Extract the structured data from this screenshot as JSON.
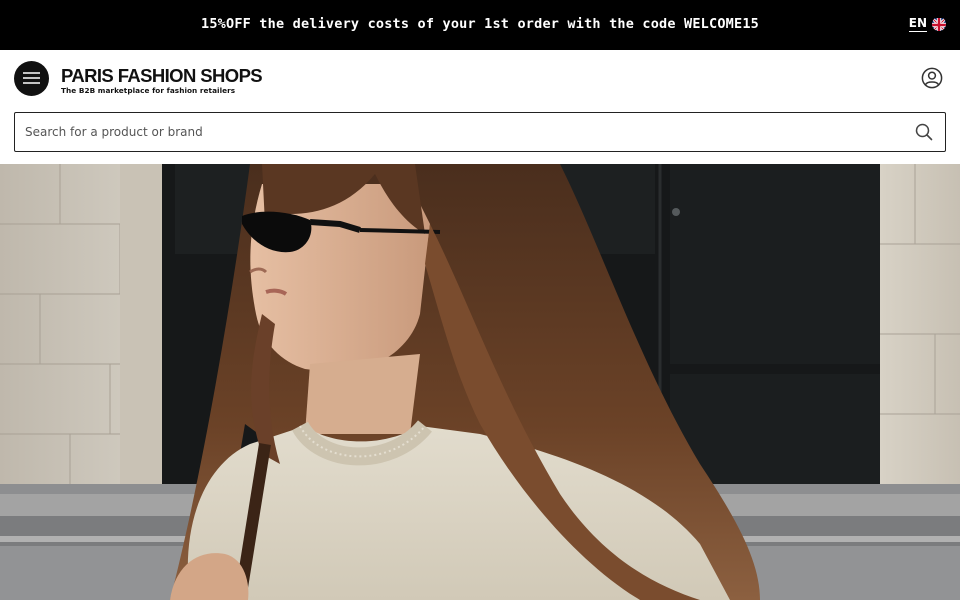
{
  "promo": {
    "text": "15%OFF the delivery costs of your 1st order with the code WELCOME15"
  },
  "language": {
    "code": "EN",
    "flag_icon": "uk-flag-icon"
  },
  "header": {
    "menu_icon": "hamburger-menu-icon",
    "logo_title": "PARIS FASHION SHOPS",
    "logo_tagline": "The B2B marketplace for fashion retailers",
    "account_icon": "user-account-icon"
  },
  "search": {
    "placeholder": "Search for a product or brand",
    "value": "",
    "icon": "search-icon"
  },
  "colors": {
    "promo_background": "#000000",
    "promo_text": "#ffffff",
    "brand_text": "#111111"
  }
}
